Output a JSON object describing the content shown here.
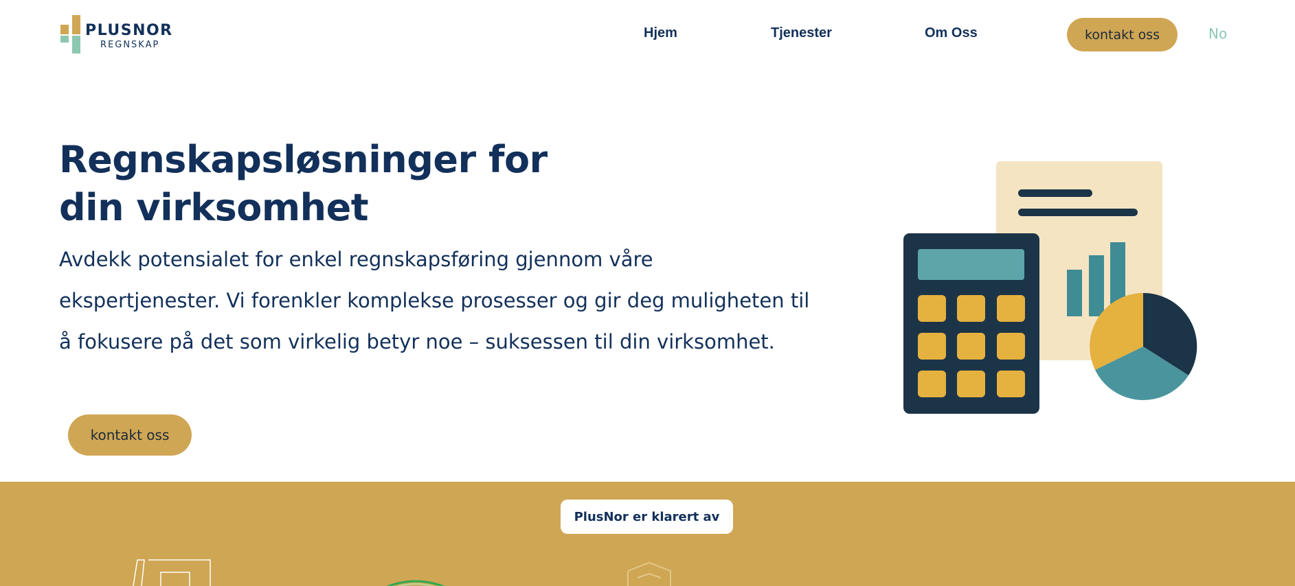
{
  "header": {
    "logo": {
      "name": "PLUSNOR",
      "sub": "REGNSKAP"
    },
    "nav": [
      {
        "label": "Hjem"
      },
      {
        "label": "Tjenester"
      },
      {
        "label": "Om Oss"
      }
    ],
    "cta_label": "kontakt oss",
    "language_label": "No"
  },
  "hero": {
    "title_line1": "Regnskapsløsninger for",
    "title_line2": "din virksomhet",
    "text_line1": "Avdekk potensialet for enkel regnskapsføring gjennom våre",
    "text_line2": "ekspertjenester. Vi forenkler komplekse prosesser og gir deg muligheten til",
    "text_line3": "å fokusere på det som virkelig betyr noe – suksessen til din virksomhet.",
    "cta_label": "kontakt oss",
    "illustration_icon": "calculator-report-pie-chart-illustration"
  },
  "certified": {
    "badge_label": "PlusNor er klarert av"
  },
  "colors": {
    "navy": "#12305a",
    "gold": "#cfa654",
    "mint": "#8cc7b2",
    "teal": "#4a959d",
    "cream": "#f4e4c2",
    "calculator": "#1c3448",
    "key": "#e5b13f"
  }
}
